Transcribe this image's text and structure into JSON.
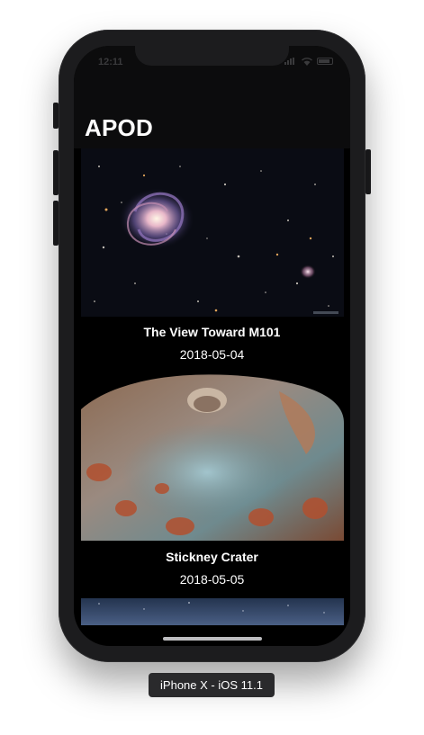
{
  "status_bar": {
    "time": "12:11"
  },
  "nav": {
    "title": "APOD"
  },
  "items": [
    {
      "title": "The View Toward M101",
      "date": "2018-05-04",
      "image": "galaxy-photo"
    },
    {
      "title": "Stickney Crater",
      "date": "2018-05-05",
      "image": "moon-crater-photo"
    },
    {
      "title": "",
      "date": "",
      "image": "night-sky-photo"
    }
  ],
  "device_label": "iPhone X - iOS 11.1",
  "colors": {
    "background": "#000000",
    "nav_bar": "#0c0c0d",
    "text": "#ffffff"
  }
}
